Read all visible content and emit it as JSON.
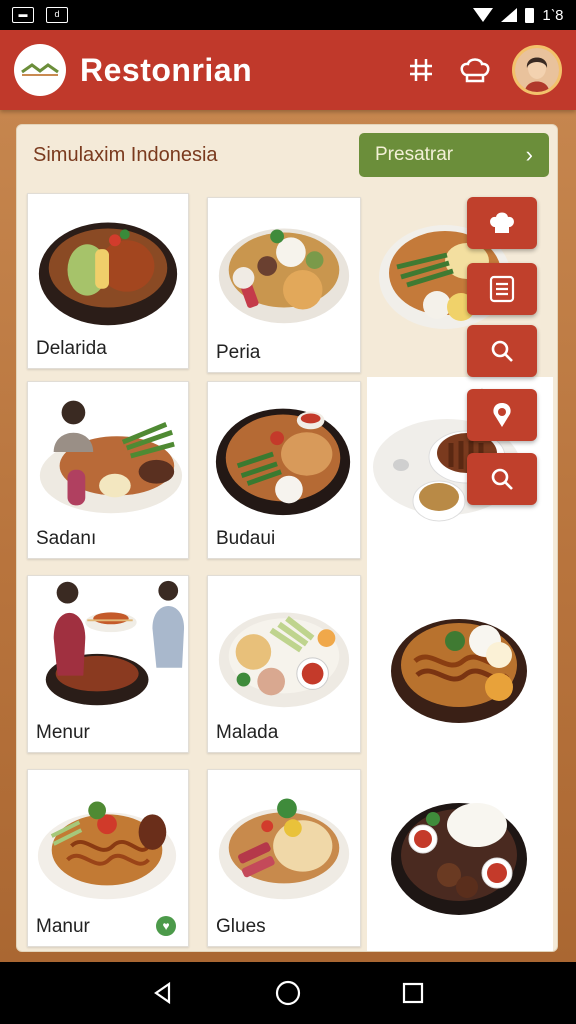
{
  "status_bar": {
    "time": "1‵8",
    "wifi_icon": "wifi-icon",
    "signal_icon": "signal-icon",
    "battery_icon": "battery-icon"
  },
  "app_bar": {
    "title": "Restonrian",
    "logo_icon": "restaurant-logo-icon",
    "actions": [
      "grid-icon",
      "chef-hat-icon"
    ],
    "avatar_icon": "user-avatar"
  },
  "section": {
    "title": "Simulaxim Indonesia",
    "button_label": "Presatrar",
    "button_icon": "chevron-right-icon"
  },
  "dishes": [
    {
      "label": "Delarida"
    },
    {
      "label": "Peria"
    },
    {
      "label": "Sadanı"
    },
    {
      "label": "Budaui"
    },
    {
      "label": "Menur"
    },
    {
      "label": "Malada"
    },
    {
      "label": "Manur"
    },
    {
      "label": "Glues"
    }
  ],
  "fab_actions": [
    "chef-hat-icon",
    "menu-list-icon",
    "search-icon",
    "location-pin-icon",
    "search-icon"
  ],
  "nav": [
    "back-icon",
    "home-icon",
    "recents-icon"
  ],
  "colors": {
    "appbar": "#c0392b",
    "button": "#6b8e3a",
    "fab": "#c0402c",
    "panel": "#f4ead8"
  }
}
